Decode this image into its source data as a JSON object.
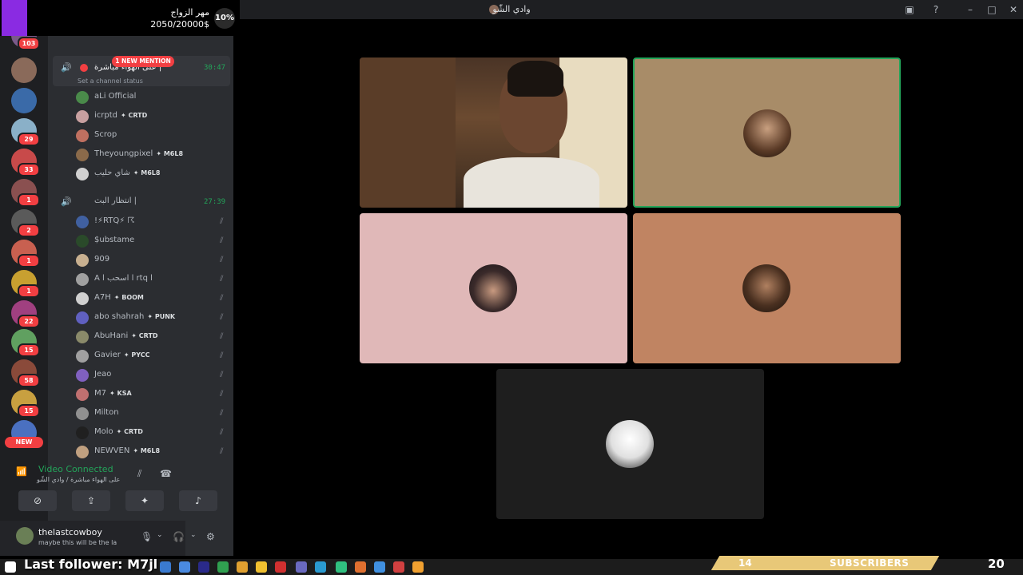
{
  "window": {
    "title": "وادي الشّو",
    "help_icon": "help-icon",
    "inbox_icon": "inbox-icon"
  },
  "donation_overlay": {
    "title": "مهر الزواج",
    "amount": "2050/20000$",
    "percent": "10%"
  },
  "server_rail": {
    "servers": [
      {
        "badge": "103"
      },
      {
        "badge": ""
      },
      {
        "badge": ""
      },
      {
        "badge": "29"
      },
      {
        "badge": "33"
      },
      {
        "badge": "1"
      },
      {
        "badge": "2"
      },
      {
        "badge": "1"
      },
      {
        "badge": "1"
      },
      {
        "badge": "22"
      },
      {
        "badge": "15"
      },
      {
        "badge": "58"
      },
      {
        "badge": "15"
      },
      {
        "badge": ""
      }
    ],
    "new_label": "NEW"
  },
  "voice_channel_1": {
    "name": "على الهواء مباشرة |",
    "mention_label": "1 NEW MENTION",
    "timer": "30:47",
    "status_placeholder": "Set a channel status",
    "members": [
      {
        "name": "aLi Official",
        "tag": ""
      },
      {
        "name": "icrptd",
        "tag": "CRTD"
      },
      {
        "name": "Scrop",
        "tag": ""
      },
      {
        "name": "Theyoungpixel",
        "tag": "M6L8"
      },
      {
        "name": "شاي حليب",
        "tag": "M6L8"
      }
    ]
  },
  "voice_channel_2": {
    "name": "انتظار البث |",
    "timer": "27:39",
    "members": [
      {
        "name": "!⚡RTQ⚡ ☈",
        "tag": ""
      },
      {
        "name": "$ubstame",
        "tag": ""
      },
      {
        "name": "909",
        "tag": ""
      },
      {
        "name": "A l اسحب l rtq l",
        "tag": ""
      },
      {
        "name": "A7H",
        "tag": "BOOM"
      },
      {
        "name": "abo shahrah",
        "tag": "PUNK"
      },
      {
        "name": "AbuHani",
        "tag": "CRTD"
      },
      {
        "name": "Gavier",
        "tag": "PYCC"
      },
      {
        "name": "Jeao",
        "tag": ""
      },
      {
        "name": "M7",
        "tag": "KSA"
      },
      {
        "name": "Milton",
        "tag": ""
      },
      {
        "name": "Molo",
        "tag": "CRTD"
      },
      {
        "name": "NEWVEN",
        "tag": "M6L8"
      }
    ]
  },
  "voice_connected": {
    "title": "Video Connected",
    "subtitle": "على الهواء مباشرة / وادي الشّو"
  },
  "user_bar": {
    "username": "thelastcowboy",
    "status": "maybe this will be the la"
  },
  "stream_overlays": {
    "last_follower": "Last follower: M7jl",
    "subs_count": "14",
    "subs_label": "SUBSCRIBERS",
    "clock": "20"
  },
  "colors": {
    "accent_green": "#23a55a",
    "badge_red": "#f23f42",
    "tile_tan": "#a88c68",
    "tile_pink": "#e0b8b8",
    "tile_orange": "#c08462",
    "tile_dark": "#1e1e1e"
  }
}
